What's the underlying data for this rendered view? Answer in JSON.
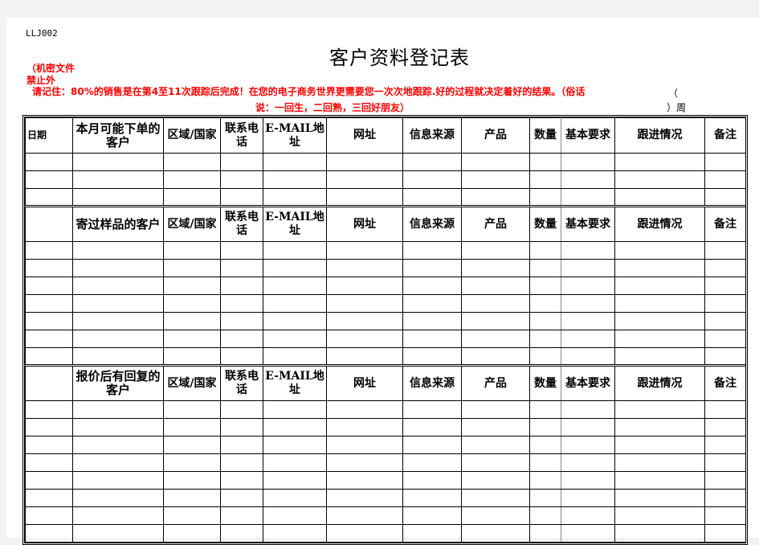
{
  "document": {
    "code": "LLJ002",
    "title": "客户资料登记表",
    "confidential": "（机密文件禁止外",
    "notice_line1": "请记住：80%的销售是在第4至11次跟踪后完成！在您的电子商务世界更需要您一次次地跟踪.好的过程就决定着好的结果。（俗话",
    "notice_line2": "说：一回生，二回熟，三回好朋友）",
    "week_open": "（",
    "week_label": "）周"
  },
  "columns": {
    "date": "日期",
    "region": "区域/国家",
    "phone": "联系电话",
    "email": "E-MAIL地址",
    "website": "网址",
    "source": "信息来源",
    "product": "产品",
    "quantity": "数量",
    "requirements": "基本要求",
    "follow_up": "跟进情况",
    "remarks": "备注"
  },
  "sections": [
    {
      "label": "本月可能下单的客户",
      "show_date_label": true,
      "row_count": 3
    },
    {
      "label": "寄过样品的客户",
      "show_date_label": false,
      "row_count": 7
    },
    {
      "label": "报价后有回复的客户",
      "show_date_label": false,
      "row_count": 8
    }
  ]
}
